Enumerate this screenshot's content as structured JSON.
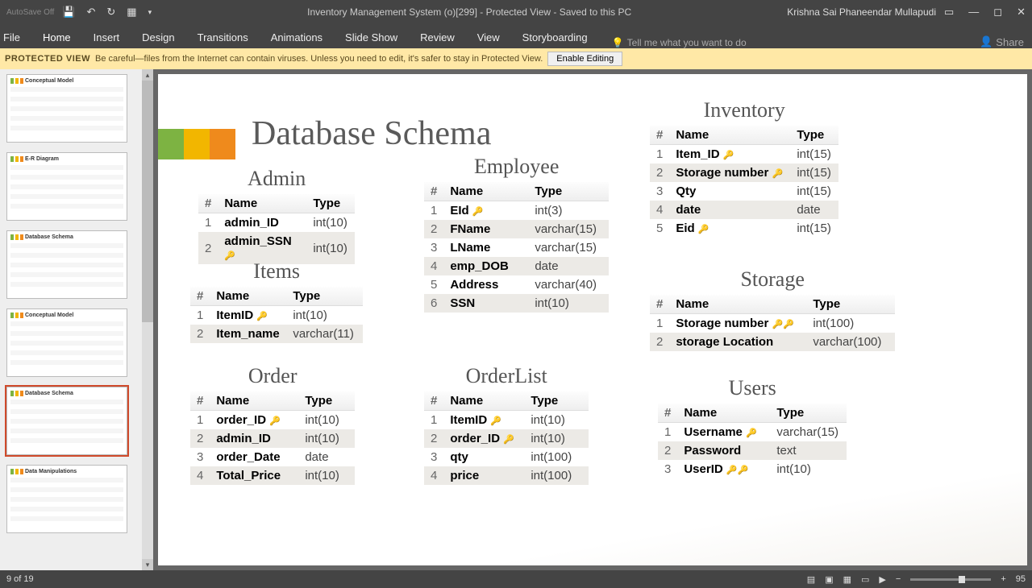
{
  "titlebar": {
    "autosave": "AutoSave Off",
    "title": "Inventory Management System (o)[299]  -  Protected View  -  Saved to this PC",
    "user": "Krishna Sai Phaneendar Mullapudi"
  },
  "ribbon": {
    "file": "File",
    "home": "Home",
    "insert": "Insert",
    "design": "Design",
    "transitions": "Transitions",
    "animations": "Animations",
    "slideshow": "Slide Show",
    "review": "Review",
    "view": "View",
    "storyboarding": "Storyboarding",
    "tellme": "Tell me what you want to do",
    "share": "Share"
  },
  "pv": {
    "label": "PROTECTED VIEW",
    "msg": "Be careful—files from the Internet can contain viruses. Unless you need to edit, it's safer to stay in Protected View.",
    "btn": "Enable Editing"
  },
  "thumbs": [
    {
      "title": "Conceptual Model"
    },
    {
      "title": "E-R Diagram"
    },
    {
      "title": "Database Schema"
    },
    {
      "title": "Conceptual Model"
    },
    {
      "title": "Database Schema"
    },
    {
      "title": "Data Manipulations"
    }
  ],
  "slide": {
    "title": "Database Schema",
    "tables": {
      "admin": {
        "name": "Admin",
        "rows": [
          {
            "n": "1",
            "name": "admin_ID",
            "type": "int(10)",
            "key": ""
          },
          {
            "n": "2",
            "name": "admin_SSN",
            "type": "int(10)",
            "key": "🔑"
          }
        ]
      },
      "items": {
        "name": "Items",
        "rows": [
          {
            "n": "1",
            "name": "ItemID",
            "type": "int(10)",
            "key": "🔑"
          },
          {
            "n": "2",
            "name": "Item_name",
            "type": "varchar(11)",
            "key": ""
          }
        ]
      },
      "order": {
        "name": "Order",
        "rows": [
          {
            "n": "1",
            "name": "order_ID",
            "type": "int(10)",
            "key": "🔑"
          },
          {
            "n": "2",
            "name": "admin_ID",
            "type": "int(10)",
            "key": ""
          },
          {
            "n": "3",
            "name": "order_Date",
            "type": "date",
            "key": ""
          },
          {
            "n": "4",
            "name": "Total_Price",
            "type": "int(10)",
            "key": ""
          }
        ]
      },
      "employee": {
        "name": "Employee",
        "rows": [
          {
            "n": "1",
            "name": "EId",
            "type": "int(3)",
            "key": "🔑"
          },
          {
            "n": "2",
            "name": "FName",
            "type": "varchar(15)",
            "key": ""
          },
          {
            "n": "3",
            "name": "LName",
            "type": "varchar(15)",
            "key": ""
          },
          {
            "n": "4",
            "name": "emp_DOB",
            "type": "date",
            "key": ""
          },
          {
            "n": "5",
            "name": "Address",
            "type": "varchar(40)",
            "key": ""
          },
          {
            "n": "6",
            "name": "SSN",
            "type": "int(10)",
            "key": ""
          }
        ]
      },
      "orderlist": {
        "name": "OrderList",
        "rows": [
          {
            "n": "1",
            "name": "ItemID",
            "type": "int(10)",
            "key": "🔑"
          },
          {
            "n": "2",
            "name": "order_ID",
            "type": "int(10)",
            "key": "🔑"
          },
          {
            "n": "3",
            "name": "qty",
            "type": "int(100)",
            "key": ""
          },
          {
            "n": "4",
            "name": "price",
            "type": "int(100)",
            "key": ""
          }
        ]
      },
      "inventory": {
        "name": "Inventory",
        "rows": [
          {
            "n": "1",
            "name": "Item_ID",
            "type": "int(15)",
            "key": "🔑"
          },
          {
            "n": "2",
            "name": "Storage number",
            "type": "int(15)",
            "key": "🔑"
          },
          {
            "n": "3",
            "name": "Qty",
            "type": "int(15)",
            "key": ""
          },
          {
            "n": "4",
            "name": "date",
            "type": "date",
            "key": ""
          },
          {
            "n": "5",
            "name": "Eid",
            "type": "int(15)",
            "key": "🔑"
          }
        ]
      },
      "storage": {
        "name": "Storage",
        "rows": [
          {
            "n": "1",
            "name": "Storage number",
            "type": "int(100)",
            "key": "🔑🔑"
          },
          {
            "n": "2",
            "name": "storage Location",
            "type": "varchar(100)",
            "key": ""
          }
        ]
      },
      "users": {
        "name": "Users",
        "rows": [
          {
            "n": "1",
            "name": "Username",
            "type": "varchar(15)",
            "key": "🔑"
          },
          {
            "n": "2",
            "name": "Password",
            "type": "text",
            "key": ""
          },
          {
            "n": "3",
            "name": "UserID",
            "type": "int(10)",
            "key": "🔑🔑"
          }
        ]
      }
    },
    "headers": {
      "n": "#",
      "name": "Name",
      "type": "Type"
    }
  },
  "status": {
    "left": "9 of 19",
    "zoom": "95"
  }
}
